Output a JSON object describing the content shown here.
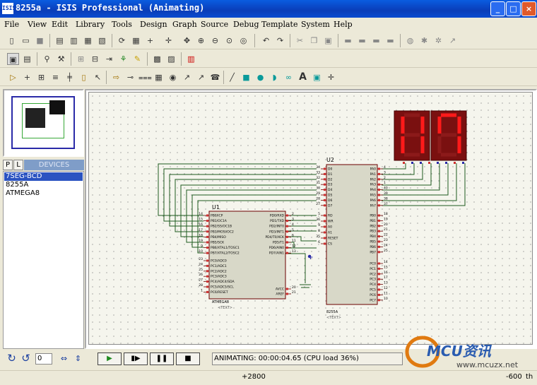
{
  "window": {
    "title": "8255a - ISIS Professional (Animating)",
    "icon_text": "ISIS"
  },
  "window_controls": {
    "minimize": "_",
    "maximize": "□",
    "close": "×"
  },
  "menu": [
    "File",
    "View",
    "Edit",
    "Library",
    "Tools",
    "Design",
    "Graph",
    "Source",
    "Debug",
    "Template",
    "System",
    "Help"
  ],
  "panel": {
    "p_label": "P",
    "l_label": "L",
    "devices_header": "DEVICES"
  },
  "devices": [
    "7SEG-BCD",
    "8255A",
    "ATMEGA8"
  ],
  "schematic": {
    "u1": {
      "ref": "U1",
      "part": "ATMEGA8",
      "text": "<TEXT>",
      "left_pins": [
        [
          "14",
          "PB0/ICP"
        ],
        [
          "15",
          "PB1/OC1A"
        ],
        [
          "16",
          "PB2/SS/OC1B"
        ],
        [
          "17",
          "PB3/MOSI/OC2"
        ],
        [
          "18",
          "PB4/MISO"
        ],
        [
          "19",
          "PB5/SCK"
        ],
        [
          "9",
          "PB6/XTAL1/TOSC1"
        ],
        [
          "10",
          "PB7/XTAL2/TOSC2"
        ],
        [
          "23",
          "PC0/ADC0"
        ],
        [
          "24",
          "PC1/ADC1"
        ],
        [
          "25",
          "PC2/ADC2"
        ],
        [
          "26",
          "PC3/ADC3"
        ],
        [
          "27",
          "PC4/ADC4/SDA"
        ],
        [
          "28",
          "PC5/ADC5/SCL"
        ],
        [
          "1",
          "PC6/RESET"
        ]
      ],
      "right_pins": [
        [
          "2",
          "PD0/RXD"
        ],
        [
          "3",
          "PD1/TXD"
        ],
        [
          "4",
          "PD2/INT0"
        ],
        [
          "5",
          "PD3/INT1"
        ],
        [
          "6",
          "PD4/T0/XCK"
        ],
        [
          "11",
          "PD5/T1"
        ],
        [
          "12",
          "PD6/AIN0"
        ],
        [
          "13",
          "PD7/AIN1"
        ],
        [
          "20",
          "AVCC"
        ],
        [
          "21",
          "AREF"
        ]
      ]
    },
    "u2": {
      "ref": "U2",
      "part": "8255A",
      "text": "<TEXT>",
      "left_pins": [
        [
          "34",
          "D0"
        ],
        [
          "33",
          "D1"
        ],
        [
          "32",
          "D2"
        ],
        [
          "31",
          "D3"
        ],
        [
          "30",
          "D4"
        ],
        [
          "29",
          "D5"
        ],
        [
          "28",
          "D6"
        ],
        [
          "27",
          "D7"
        ],
        [
          "5",
          "RD"
        ],
        [
          "36",
          "WR"
        ],
        [
          "9",
          "A0"
        ],
        [
          "8",
          "A1"
        ],
        [
          "35",
          "RESET"
        ],
        [
          "6",
          "CS"
        ]
      ],
      "right_pins": [
        [
          "4",
          "PA0"
        ],
        [
          "3",
          "PA1"
        ],
        [
          "2",
          "PA2"
        ],
        [
          "1",
          "PA3"
        ],
        [
          "40",
          "PA4"
        ],
        [
          "39",
          "PA5"
        ],
        [
          "38",
          "PA6"
        ],
        [
          "37",
          "PA7"
        ],
        [
          "18",
          "PB0"
        ],
        [
          "19",
          "PB1"
        ],
        [
          "20",
          "PB2"
        ],
        [
          "21",
          "PB3"
        ],
        [
          "22",
          "PB4"
        ],
        [
          "23",
          "PB5"
        ],
        [
          "24",
          "PB6"
        ],
        [
          "25",
          "PB7"
        ],
        [
          "14",
          "PC0"
        ],
        [
          "15",
          "PC1"
        ],
        [
          "16",
          "PC2"
        ],
        [
          "17",
          "PC3"
        ],
        [
          "13",
          "PC4"
        ],
        [
          "12",
          "PC5"
        ],
        [
          "11",
          "PC6"
        ],
        [
          "10",
          "PC7"
        ]
      ]
    }
  },
  "status": {
    "text": "ANIMATING: 00:00:04.65 (CPU load 36%)",
    "rotation_value": "0"
  },
  "coords": {
    "x": "+2800",
    "y": "-600",
    "unit": "th"
  },
  "watermark": {
    "brand": "MCU资讯",
    "url": "www.mcuzx.net"
  }
}
